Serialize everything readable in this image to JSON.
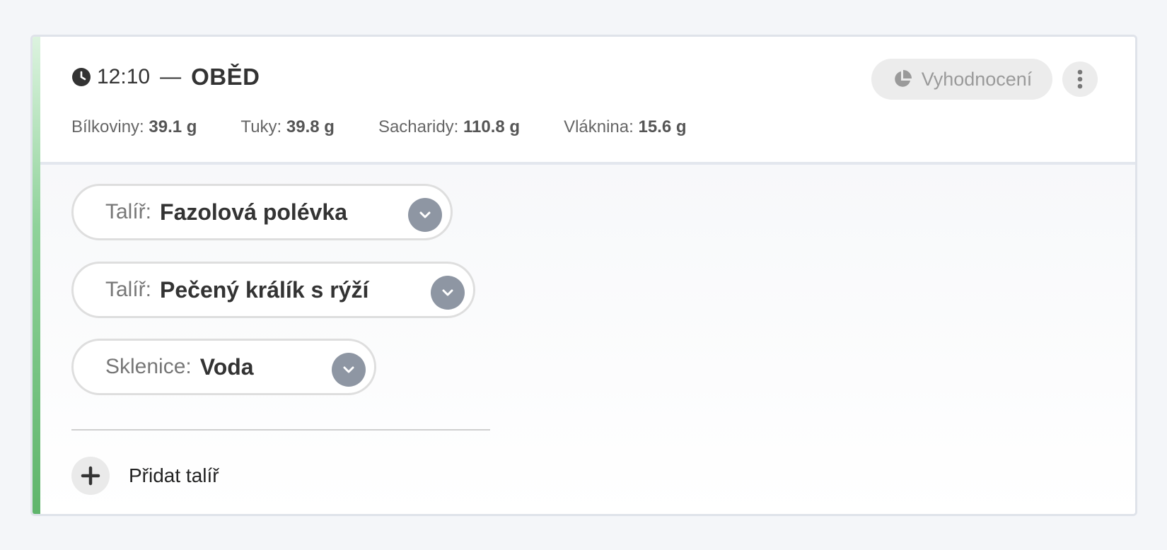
{
  "meal": {
    "time": "12:10",
    "separator": "—",
    "name": "OBĚD"
  },
  "nutrients": [
    {
      "label": "Bílkoviny:",
      "value": "39.1 g"
    },
    {
      "label": "Tuky:",
      "value": "39.8 g"
    },
    {
      "label": "Sacharidy:",
      "value": "110.8 g"
    },
    {
      "label": "Vláknina:",
      "value": "15.6 g"
    }
  ],
  "actions": {
    "evaluation_label": "Vyhodnocení"
  },
  "plates": [
    {
      "kind": "Talíř:",
      "name": "Fazolová polévka"
    },
    {
      "kind": "Talíř:",
      "name": "Pečený králík s rýží"
    },
    {
      "kind": "Sklenice:",
      "name": "Voda"
    }
  ],
  "add_plate": {
    "label": "Přidat talíř"
  },
  "colors": {
    "accent_green": "#5fb56c",
    "chevron_bg": "#8e96a3",
    "page_bg": "#f4f6f9"
  },
  "icons": {
    "clock": "clock-icon",
    "pie": "pie-chart-icon",
    "more": "more-vertical-icon",
    "chevron": "chevron-down-icon",
    "plus": "plus-icon"
  }
}
